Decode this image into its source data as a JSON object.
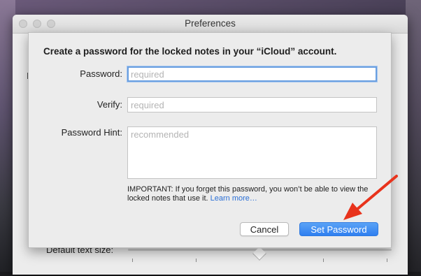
{
  "window": {
    "title": "Preferences",
    "partial_label": "I",
    "default_text_size_label": "Default text size:"
  },
  "sheet": {
    "heading": "Create a password for the locked notes in your “iCloud” account.",
    "password": {
      "label": "Password:",
      "placeholder": "required",
      "value": ""
    },
    "verify": {
      "label": "Verify:",
      "placeholder": "required",
      "value": ""
    },
    "hint": {
      "label": "Password Hint:",
      "placeholder": "recommended",
      "value": ""
    },
    "important_text": "IMPORTANT: If you forget this password, you won’t be able to view the locked notes that use it.",
    "learn_more": "Learn more…",
    "cancel_label": "Cancel",
    "set_password_label": "Set Password"
  },
  "colors": {
    "accent": "#2f7ff0",
    "link": "#2a6fd6",
    "annotation": "#e8331c"
  },
  "icons": {
    "annotation": "red-arrow-icon"
  }
}
